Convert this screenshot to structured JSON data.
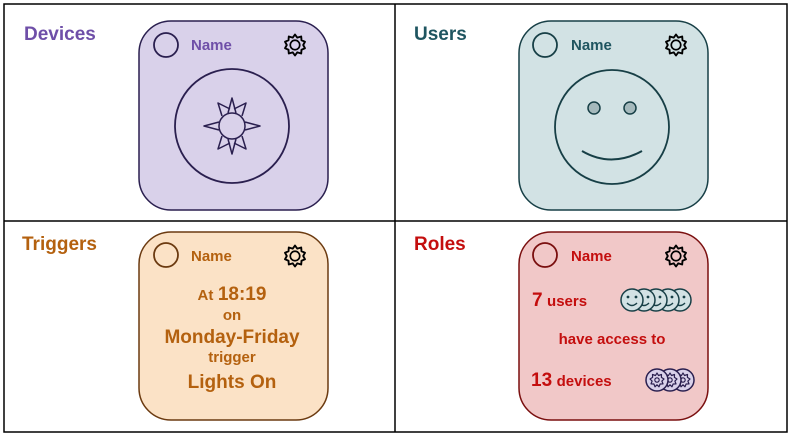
{
  "colors": {
    "devices": {
      "accent": "#6f4fa8",
      "fill": "#d9d1ea",
      "stroke": "#2a1f4f"
    },
    "users": {
      "accent": "#1f5560",
      "fill": "#d2e2e4",
      "stroke": "#173f46"
    },
    "triggers": {
      "accent": "#b4610f",
      "fill": "#fbe2c6",
      "stroke": "#6b3a10"
    },
    "roles": {
      "accent": "#c40e0e",
      "fill": "#f1c8c8",
      "stroke": "#7a0f0f"
    }
  },
  "panels": {
    "devices": {
      "title": "Devices",
      "card_name": "Name",
      "icon": "sun-icon"
    },
    "users": {
      "title": "Users",
      "card_name": "Name",
      "icon": "smiley-face-icon"
    },
    "triggers": {
      "title": "Triggers",
      "card_name": "Name",
      "at_prefix": "At",
      "time": "18:19",
      "on_label": "on",
      "days": "Monday-Friday",
      "trigger_label": "trigger",
      "action": "Lights On"
    },
    "roles": {
      "title": "Roles",
      "card_name": "Name",
      "user_count": "7",
      "users_label": "users",
      "access_text": "have access to",
      "device_count": "13",
      "devices_label": "devices"
    }
  }
}
